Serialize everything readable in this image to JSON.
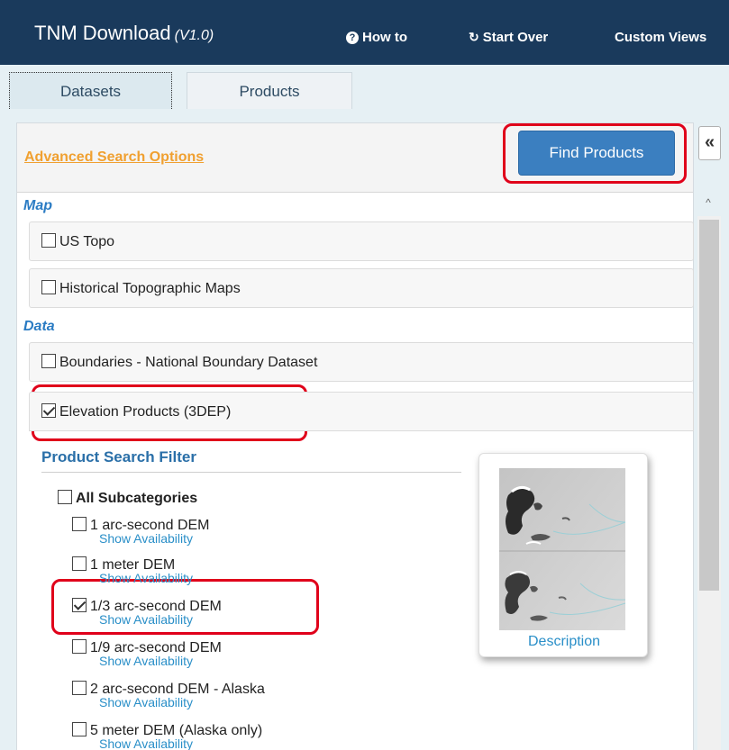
{
  "header": {
    "title": "TNM Download",
    "version": "(V1.0)",
    "links": [
      {
        "label": "How to",
        "icon": "question-circle-icon"
      },
      {
        "label": "Start Over",
        "icon": "refresh-icon"
      },
      {
        "label": "Custom Views",
        "icon": ""
      }
    ]
  },
  "tabs": [
    {
      "label": "Datasets",
      "active": true
    },
    {
      "label": "Products",
      "active": false
    }
  ],
  "panel": {
    "advanced_search_label": "Advanced Search Options",
    "find_products_label": "Find Products",
    "collapse_icon": "«",
    "scroll_up_icon": "^"
  },
  "sections": {
    "map_label": "Map",
    "data_label": "Data"
  },
  "map_items": [
    {
      "label": "US Topo",
      "checked": false
    },
    {
      "label": "Historical Topographic Maps",
      "checked": false
    }
  ],
  "data_items": [
    {
      "label": "Boundaries - National Boundary Dataset",
      "checked": false
    },
    {
      "label": "Elevation Products (3DEP)",
      "checked": true
    }
  ],
  "filter": {
    "title": "Product Search Filter",
    "all_subcategories": "All Subcategories",
    "show_availability": "Show Availability",
    "items": [
      {
        "label": "1 arc-second DEM",
        "checked": false
      },
      {
        "label": "1 meter DEM",
        "checked": false
      },
      {
        "label": "1/3 arc-second DEM",
        "checked": true
      },
      {
        "label": "1/9 arc-second DEM",
        "checked": false
      },
      {
        "label": "2 arc-second DEM - Alaska",
        "checked": false
      },
      {
        "label": "5 meter DEM (Alaska only)",
        "checked": false
      }
    ]
  },
  "thumbnail": {
    "description_label": "Description"
  },
  "colors": {
    "header_bg": "#1a3a5c",
    "accent_orange": "#f0a030",
    "button_blue": "#3b7fc0",
    "link_blue": "#2a8fc8",
    "highlight_red": "#e0001a"
  }
}
